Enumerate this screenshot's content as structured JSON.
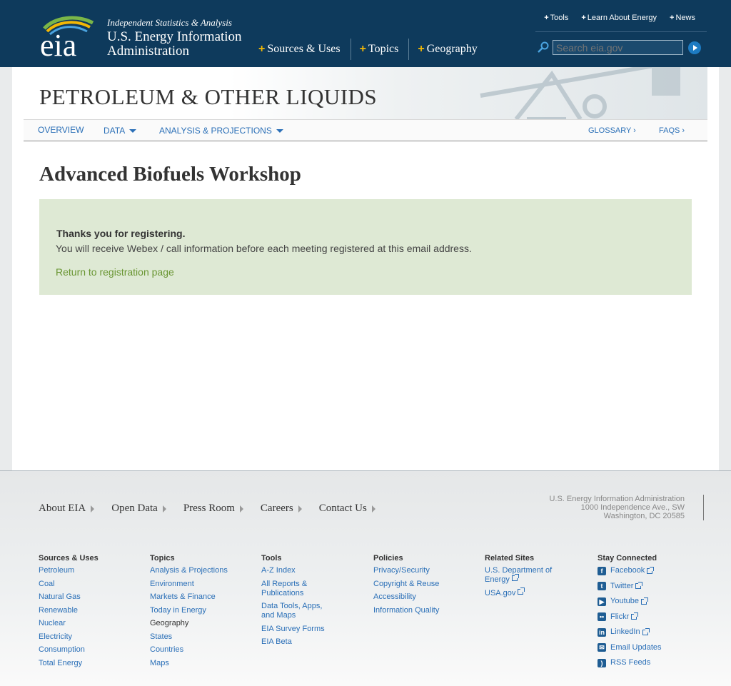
{
  "header": {
    "logo_text": "eia",
    "tagline": "Independent Statistics & Analysis",
    "org_line1": "U.S. Energy Information",
    "org_line2": "Administration",
    "main_nav": [
      "Sources & Uses",
      "Topics",
      "Geography"
    ],
    "util_nav": [
      "Tools",
      "Learn About Energy",
      "News"
    ],
    "search_placeholder": "Search eia.gov"
  },
  "banner": {
    "title": "PETROLEUM & OTHER LIQUIDS"
  },
  "subnav": {
    "overview": "OVERVIEW",
    "data": "DATA",
    "analysis": "ANALYSIS & PROJECTIONS",
    "glossary": "GLOSSARY ›",
    "faqs": "FAQS ›"
  },
  "main": {
    "page_title": "Advanced Biofuels Workshop",
    "notice_heading": "Thanks you for registering.",
    "notice_body": "You will receive Webex / call information before each meeting registered at this email address.",
    "notice_link": "Return to registration page"
  },
  "footer": {
    "nav": [
      "About EIA",
      "Open Data",
      "Press Room",
      "Careers",
      "Contact Us"
    ],
    "address": [
      "U.S. Energy Information Administration",
      "1000 Independence Ave., SW",
      "Washington, DC 20585"
    ],
    "columns": {
      "sources": {
        "heading": "Sources & Uses",
        "links": [
          "Petroleum",
          "Coal",
          "Natural Gas",
          "Renewable",
          "Nuclear",
          "Electricity",
          "Consumption",
          "Total Energy"
        ]
      },
      "topics": {
        "heading": "Topics",
        "links": [
          "Analysis & Projections",
          "Environment",
          "Markets & Finance",
          "Today in Energy"
        ],
        "subheading": "Geography",
        "sublinks": [
          "States",
          "Countries",
          "Maps"
        ]
      },
      "tools": {
        "heading": "Tools",
        "links": [
          "A-Z Index",
          "All Reports & Publications",
          "Data Tools, Apps, and Maps",
          "EIA Survey Forms",
          "EIA Beta"
        ]
      },
      "policies": {
        "heading": "Policies",
        "links": [
          "Privacy/Security",
          "Copyright & Reuse",
          "Accessibility",
          "Information Quality"
        ]
      },
      "related": {
        "heading": "Related Sites",
        "links": [
          "U.S. Department of Energy",
          "USA.gov"
        ]
      },
      "social": {
        "heading": "Stay Connected",
        "links": [
          "Facebook",
          "Twitter",
          "Youtube",
          "Flickr",
          "LinkedIn",
          "Email Updates",
          "RSS Feeds"
        ]
      }
    }
  },
  "colors": {
    "header_bg": "#0e3a5c",
    "accent_yellow": "#f2b705",
    "link_blue": "#2a6fb7",
    "notice_bg": "#dee9d4",
    "notice_link": "#6a9633"
  }
}
